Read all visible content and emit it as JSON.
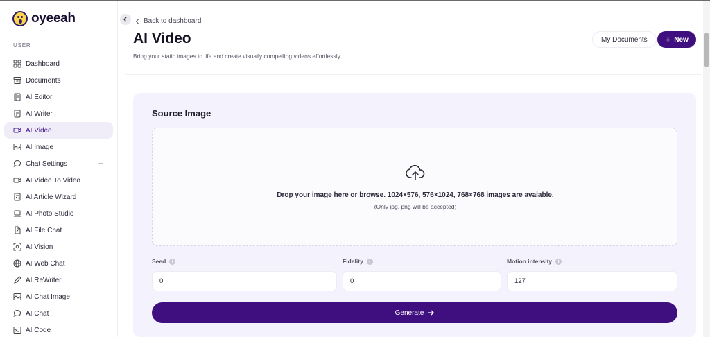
{
  "brand": {
    "name": "oyeeah"
  },
  "sidebar": {
    "section_label": "USER",
    "items": [
      {
        "label": "Dashboard",
        "icon": "dashboard-icon"
      },
      {
        "label": "Documents",
        "icon": "archive-icon"
      },
      {
        "label": "AI Editor",
        "icon": "editor-icon"
      },
      {
        "label": "AI Writer",
        "icon": "writer-icon"
      },
      {
        "label": "AI Video",
        "icon": "video-icon",
        "active": true
      },
      {
        "label": "AI Image",
        "icon": "image-icon"
      },
      {
        "label": "Chat Settings",
        "icon": "chat-icon",
        "expandable": "+"
      },
      {
        "label": "AI Video To Video",
        "icon": "video-icon"
      },
      {
        "label": "AI Article Wizard",
        "icon": "wizard-icon"
      },
      {
        "label": "AI Photo Studio",
        "icon": "laptop-icon"
      },
      {
        "label": "AI File Chat",
        "icon": "file-icon"
      },
      {
        "label": "AI Vision",
        "icon": "vision-icon"
      },
      {
        "label": "AI Web Chat",
        "icon": "globe-icon"
      },
      {
        "label": "AI ReWriter",
        "icon": "pen-icon"
      },
      {
        "label": "AI Chat Image",
        "icon": "image-icon"
      },
      {
        "label": "AI Chat",
        "icon": "chat-icon"
      },
      {
        "label": "AI Code",
        "icon": "terminal-icon"
      }
    ]
  },
  "header": {
    "back_label": "Back to dashboard",
    "title": "AI Video",
    "subtitle": "Bring your static images to life and create visually compelling videos effortlessly.",
    "docs_button": "My Documents",
    "new_button": "New"
  },
  "form": {
    "card_title": "Source Image",
    "drop_text": "Drop your image here or browse. 1024×576, 576×1024, 768×768 images are avaiable.",
    "drop_sub": "(Only jpg, png will be accepted)",
    "fields": [
      {
        "label": "Seed",
        "value": "0"
      },
      {
        "label": "Fidelity",
        "value": "0"
      },
      {
        "label": "Motion intensity",
        "value": "127"
      }
    ],
    "generate_label": "Generate",
    "info_glyph": "i"
  },
  "colors": {
    "accent": "#3f0f80",
    "card_bg": "#f4f2fc",
    "active_bg": "#f0edf8"
  }
}
